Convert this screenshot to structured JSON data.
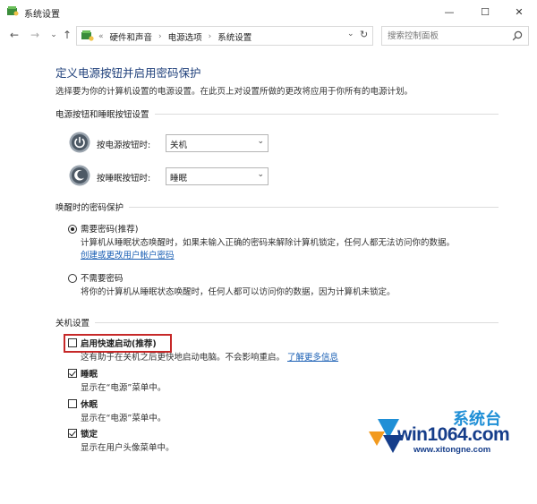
{
  "window": {
    "title": "系统设置",
    "controls": {
      "minimize": "—",
      "maximize": "☐",
      "close": "✕"
    }
  },
  "address_bar": {
    "back": "←",
    "forward": "→",
    "recent": "⌄",
    "up": "↑",
    "breadcrumb_prefix": "«",
    "breadcrumbs": [
      "硬件和声音",
      "电源选项",
      "系统设置"
    ],
    "separator": "›",
    "dropdown": "⌄",
    "refresh": "↻",
    "search_placeholder": "搜索控制面板"
  },
  "page": {
    "title": "定义电源按钮并启用密码保护",
    "description": "选择要为你的计算机设置的电源设置。在此页上对设置所做的更改将应用于你所有的电源计划。"
  },
  "buttons_section": {
    "header": "电源按钮和睡眠按钮设置",
    "power_button": {
      "label": "按电源按钮时:",
      "value": "关机"
    },
    "sleep_button": {
      "label": "按睡眠按钮时:",
      "value": "睡眠"
    },
    "chevron": "⌄"
  },
  "password_section": {
    "header": "唤醒时的密码保护",
    "require": {
      "label": "需要密码(推荐)",
      "desc": "计算机从睡眠状态唤醒时，如果未输入正确的密码来解除计算机锁定，任何人都无法访问你的数据。",
      "link": "创建或更改用户帐户密码",
      "checked": true
    },
    "no_require": {
      "label": "不需要密码",
      "desc": "将你的计算机从睡眠状态唤醒时，任何人都可以访问你的数据，因为计算机未锁定。",
      "checked": false
    }
  },
  "shutdown_section": {
    "header": "关机设置",
    "fast_startup": {
      "label": "启用快速启动(推荐)",
      "desc": "这有助于在关机之后更快地启动电脑。不会影响重启。",
      "link": "了解更多信息",
      "checked": false
    },
    "sleep": {
      "label": "睡眠",
      "desc": "显示在“电源”菜单中。",
      "checked": true
    },
    "hibernate": {
      "label": "休眠",
      "desc": "显示在“电源”菜单中。",
      "checked": false
    },
    "lock": {
      "label": "锁定",
      "desc": "显示在用户头像菜单中。",
      "checked": true
    }
  },
  "watermark": {
    "brand": "win1064.com",
    "top_text": "系统台",
    "url": "www.xitongne.com",
    "colors": {
      "dark": "#153d8a",
      "light": "#1f8fd6",
      "accent": "#f29a1e"
    }
  },
  "colors": {
    "title": "#1e3f7a",
    "link": "#1a5fb4",
    "highlight": "#c62828"
  }
}
